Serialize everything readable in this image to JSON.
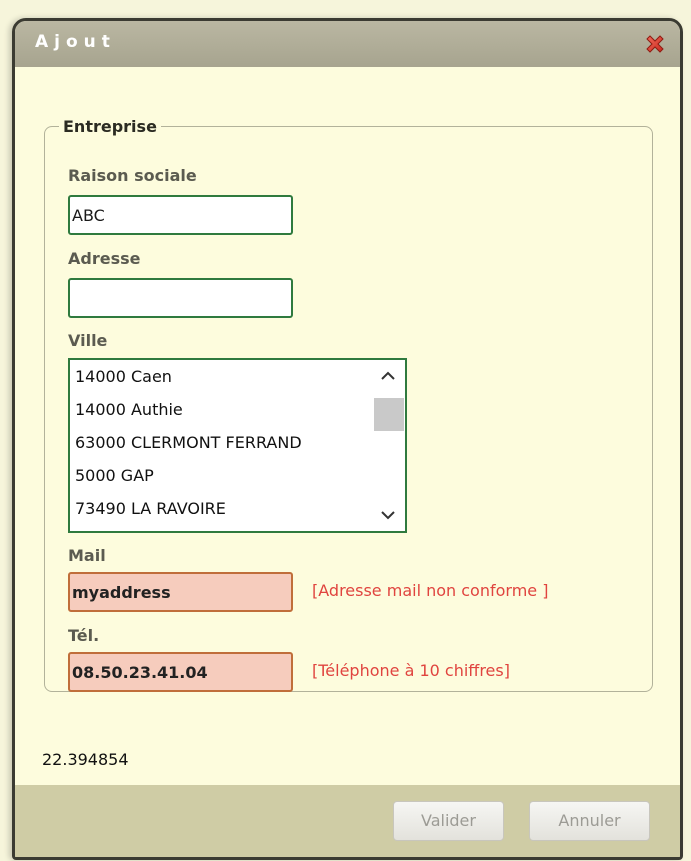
{
  "dialog": {
    "title": "Ajout",
    "close_icon": "close-x-icon"
  },
  "group": {
    "legend": "Entreprise"
  },
  "fields": {
    "raison_sociale": {
      "label": "Raison sociale",
      "value": "ABC"
    },
    "adresse": {
      "label": "Adresse",
      "value": ""
    },
    "ville": {
      "label": "Ville",
      "options": [
        "14000 Caen",
        "14000 Authie",
        "63000 CLERMONT FERRAND",
        "5000 GAP",
        "73490 LA RAVOIRE"
      ]
    },
    "mail": {
      "label": "Mail",
      "value": "myaddress",
      "error": "[Adresse mail non conforme ]"
    },
    "tel": {
      "label": "Tél.",
      "value": "08.50.23.41.04",
      "error": "[Téléphone à 10 chiffres]"
    }
  },
  "status_value": "22.394854",
  "footer": {
    "validate_label": "Valider",
    "cancel_label": "Annuler"
  },
  "colors": {
    "input_border_ok": "#2f7a3e",
    "input_border_error": "#c06e3a",
    "input_bg_error": "#f6ccbd",
    "error_text": "#e0443f",
    "titlebar": "#b0ad98"
  }
}
